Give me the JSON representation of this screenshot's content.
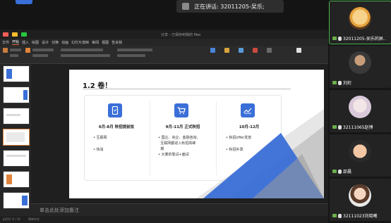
{
  "meeting": {
    "speaking_label": "正在讲话: 32011205-吴乐;"
  },
  "ppt": {
    "window_title": "分享 - 已保存到我的 Mac",
    "tabs": [
      "文件",
      "开始",
      "插入",
      "绘图",
      "设计",
      "切换",
      "动画",
      "幻灯片放映",
      "审阅",
      "视图",
      "告诉我"
    ],
    "active_tab_index": 1,
    "notes_placeholder": "单击此处添加备注",
    "status_left": "幻灯片 4 / 10",
    "status_right": "简体中文"
  },
  "slide": {
    "title": "1.2 卷！",
    "columns": [
      {
        "icon": "phone-icon",
        "heading": "6月-8月 秋招提前批",
        "items": [
          "互联网",
          "快消"
        ]
      },
      {
        "icon": "cart-icon",
        "heading": "9月-11月 正式秋招",
        "items": [
          "国企、央企、金融咨询、",
          "互联网都进入秋招高峰",
          "期",
          "大量的笔试+面试"
        ]
      },
      {
        "icon": "chart-icon",
        "heading": "10月-12月",
        "items": [
          "秋招offer发放",
          "秋招补录"
        ]
      }
    ],
    "accent_color": "#3a6fd8"
  },
  "participants": [
    {
      "name": "32011205-吴乐的屏..",
      "active": true,
      "avatar": "cartoon-avatar"
    },
    {
      "name": "刘珩",
      "active": false,
      "avatar": "photo-avatar"
    },
    {
      "name": "32111065赵博",
      "active": false,
      "avatar": "anime-avatar"
    },
    {
      "name": "邵晨",
      "active": false,
      "avatar": "baby-avatar"
    },
    {
      "name": "32111023刘晓曦",
      "active": false,
      "avatar": "girl-avatar"
    }
  ]
}
